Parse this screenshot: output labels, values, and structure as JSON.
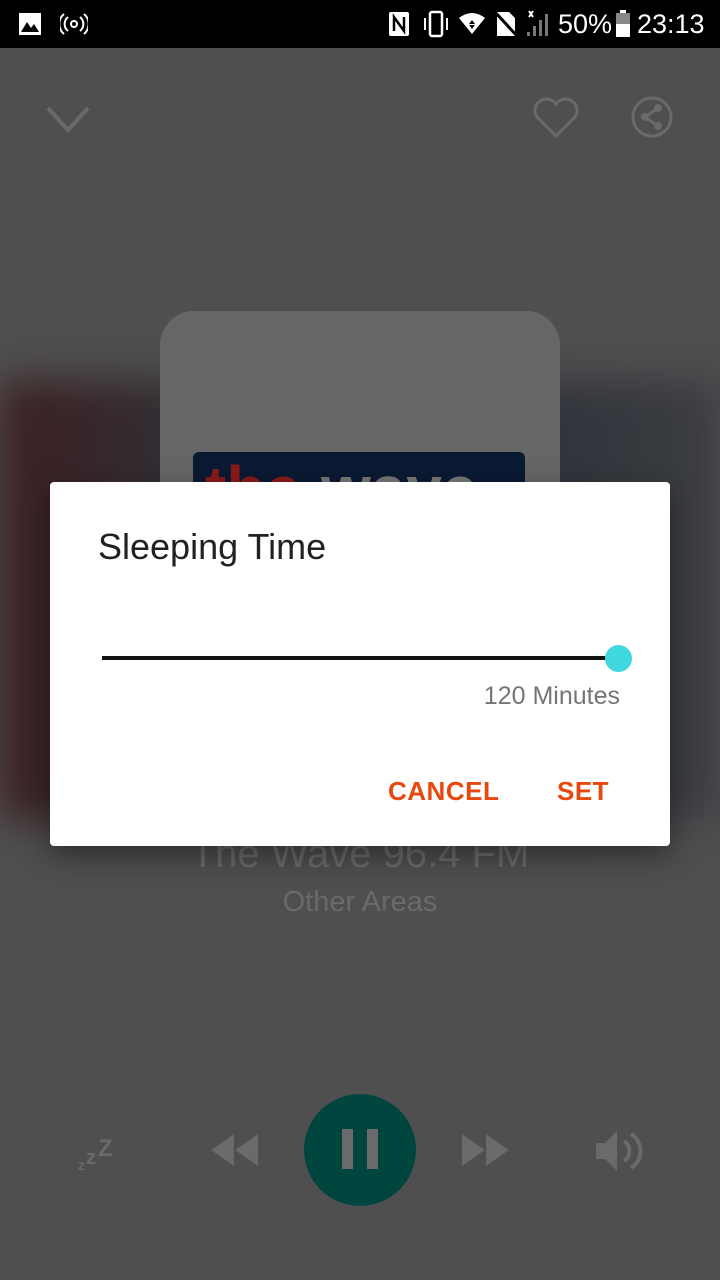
{
  "status_bar": {
    "battery": "50%",
    "time": "23:13"
  },
  "player": {
    "station_name": "The Wave 96.4 FM",
    "station_area": "Other Areas",
    "logo_text": "thewave",
    "accent_color": "#00463e"
  },
  "dialog": {
    "title": "Sleeping Time",
    "slider": {
      "value": 120,
      "max": 120,
      "fraction": 1.0,
      "thumb_color": "#3fd8e0"
    },
    "value_label": "120 Minutes",
    "cancel_label": "CANCEL",
    "set_label": "SET",
    "button_color": "#e8470e"
  }
}
